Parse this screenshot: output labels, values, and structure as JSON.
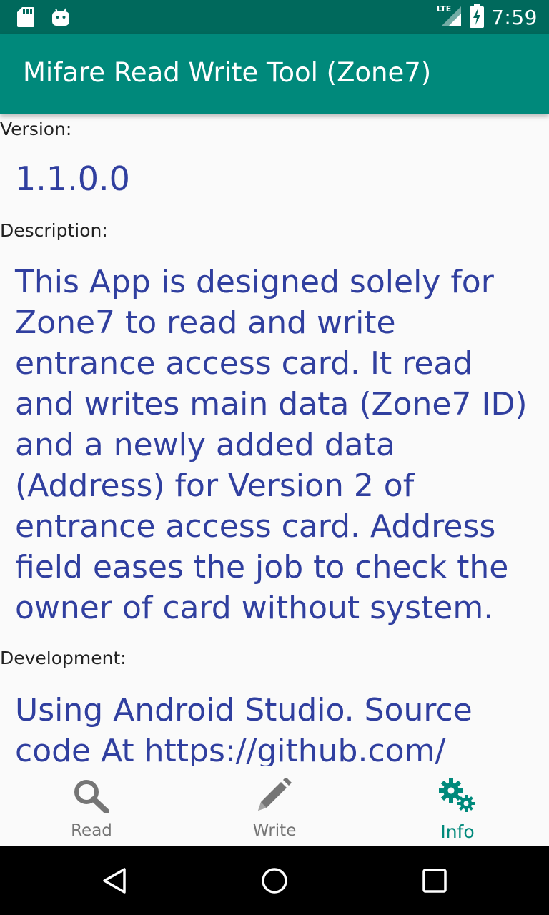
{
  "status_bar": {
    "time": "7:59",
    "network": "LTE",
    "left_icons": [
      "sd-card-icon",
      "android-icon"
    ],
    "bg_color": "#00695c"
  },
  "app_bar": {
    "title": "Mifare Read Write Tool (Zone7)",
    "bg_color": "#00897b"
  },
  "info": {
    "version_label": "Version:",
    "version_value": "1.1.0.0",
    "description_label": "Description:",
    "description_value": "This App is designed solely for Zone7 to read and write entrance access card. It read and writes main data (Zone7 ID) and a newly added data (Address) for Version 2 of entrance access card. Address field eases the job to check the owner of card without system.",
    "development_label": "Development:",
    "development_value": "Using Android Studio. Source code At https://github.com/",
    "value_color": "#303f9f"
  },
  "bottom_nav": {
    "items": [
      {
        "label": "Read",
        "icon": "search-icon",
        "active": false
      },
      {
        "label": "Write",
        "icon": "pencil-icon",
        "active": false
      },
      {
        "label": "Info",
        "icon": "gears-icon",
        "active": true
      }
    ],
    "active_color": "#00897b",
    "inactive_color": "#757575"
  },
  "system_nav": {
    "buttons": [
      "back-icon",
      "home-icon",
      "recents-icon"
    ]
  }
}
